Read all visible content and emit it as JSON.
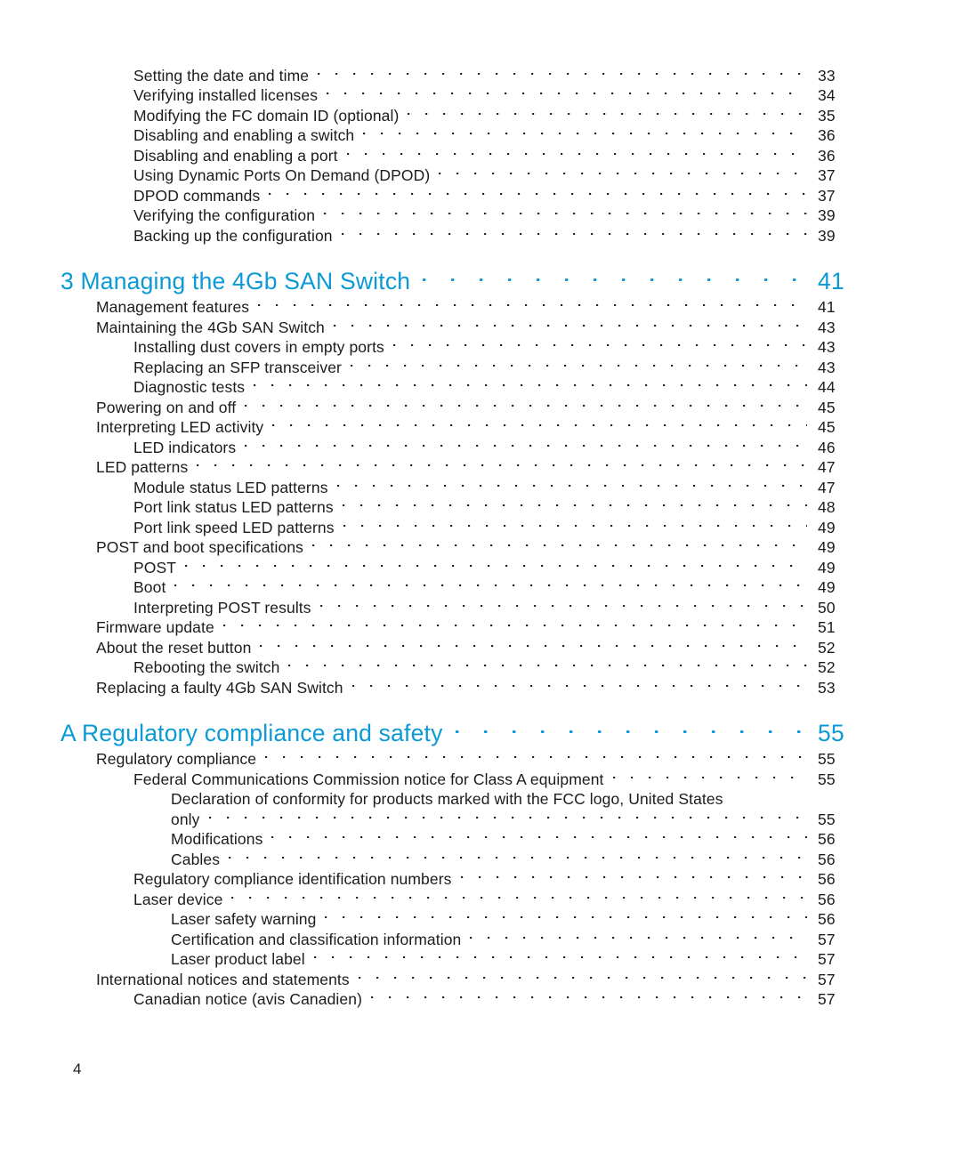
{
  "document": {
    "page_number": "4",
    "accent_color": "#0b9ad6",
    "text_color": "#1c1c1c"
  },
  "toc": {
    "blocks": [
      {
        "type": "entries",
        "entries": [
          {
            "level": 2,
            "title": "Setting the date and time",
            "page": "33"
          },
          {
            "level": 2,
            "title": "Verifying installed licenses",
            "page": "34"
          },
          {
            "level": 2,
            "title": "Modifying the FC domain ID (optional)",
            "page": "35"
          },
          {
            "level": 2,
            "title": "Disabling and enabling a switch",
            "page": "36"
          },
          {
            "level": 2,
            "title": "Disabling and enabling a port",
            "page": "36"
          },
          {
            "level": 2,
            "title": "Using Dynamic Ports On Demand (DPOD)",
            "page": "37"
          },
          {
            "level": 2,
            "title": "DPOD commands",
            "page": "37"
          },
          {
            "level": 2,
            "title": "Verifying the configuration",
            "page": "39"
          },
          {
            "level": 2,
            "title": "Backing up the configuration",
            "page": "39"
          }
        ]
      },
      {
        "type": "chapter",
        "chapter": {
          "title": "3 Managing the 4Gb SAN Switch",
          "page": "41"
        },
        "entries": [
          {
            "level": 1,
            "title": "Management features",
            "page": "41"
          },
          {
            "level": 1,
            "title": "Maintaining the 4Gb SAN Switch",
            "page": "43"
          },
          {
            "level": 2,
            "title": "Installing dust covers in empty ports",
            "page": "43"
          },
          {
            "level": 2,
            "title": "Replacing an SFP transceiver",
            "page": "43"
          },
          {
            "level": 2,
            "title": "Diagnostic tests",
            "page": "44"
          },
          {
            "level": 1,
            "title": "Powering on and off",
            "page": "45"
          },
          {
            "level": 1,
            "title": "Interpreting LED activity",
            "page": "45"
          },
          {
            "level": 2,
            "title": "LED indicators",
            "page": "46"
          },
          {
            "level": 1,
            "title": "LED patterns",
            "page": "47"
          },
          {
            "level": 2,
            "title": "Module status LED patterns",
            "page": "47"
          },
          {
            "level": 2,
            "title": "Port link status LED patterns",
            "page": "48"
          },
          {
            "level": 2,
            "title": "Port link speed LED patterns",
            "page": "49"
          },
          {
            "level": 1,
            "title": "POST and boot specifications",
            "page": "49"
          },
          {
            "level": 2,
            "title": "POST",
            "page": "49"
          },
          {
            "level": 2,
            "title": "Boot",
            "page": "49"
          },
          {
            "level": 2,
            "title": "Interpreting POST results",
            "page": "50"
          },
          {
            "level": 1,
            "title": "Firmware update",
            "page": "51"
          },
          {
            "level": 1,
            "title": "About the reset button",
            "page": "52"
          },
          {
            "level": 2,
            "title": "Rebooting the switch",
            "page": "52"
          },
          {
            "level": 1,
            "title": "Replacing a faulty 4Gb SAN Switch",
            "page": "53"
          }
        ]
      },
      {
        "type": "chapter",
        "chapter": {
          "title": "A Regulatory compliance and safety",
          "page": "55"
        },
        "entries": [
          {
            "level": 1,
            "title": "Regulatory compliance",
            "page": "55"
          },
          {
            "level": 2,
            "title": "Federal Communications Commission notice for Class A equipment",
            "page": "55"
          },
          {
            "level": 3,
            "title": "Declaration of conformity for products marked with the FCC logo, United States",
            "page": "",
            "wrapped": true
          },
          {
            "level": 3,
            "title": "only",
            "page": "55"
          },
          {
            "level": 3,
            "title": "Modifications",
            "page": "56"
          },
          {
            "level": 3,
            "title": "Cables",
            "page": "56"
          },
          {
            "level": 2,
            "title": "Regulatory compliance identification numbers",
            "page": "56"
          },
          {
            "level": 2,
            "title": "Laser device",
            "page": "56"
          },
          {
            "level": 3,
            "title": "Laser safety warning",
            "page": "56"
          },
          {
            "level": 3,
            "title": "Certification and classification information",
            "page": "57"
          },
          {
            "level": 3,
            "title": "Laser product label",
            "page": "57"
          },
          {
            "level": 1,
            "title": "International notices and statements",
            "page": "57"
          },
          {
            "level": 2,
            "title": "Canadian notice (avis Canadien)",
            "page": "57"
          }
        ]
      }
    ]
  }
}
